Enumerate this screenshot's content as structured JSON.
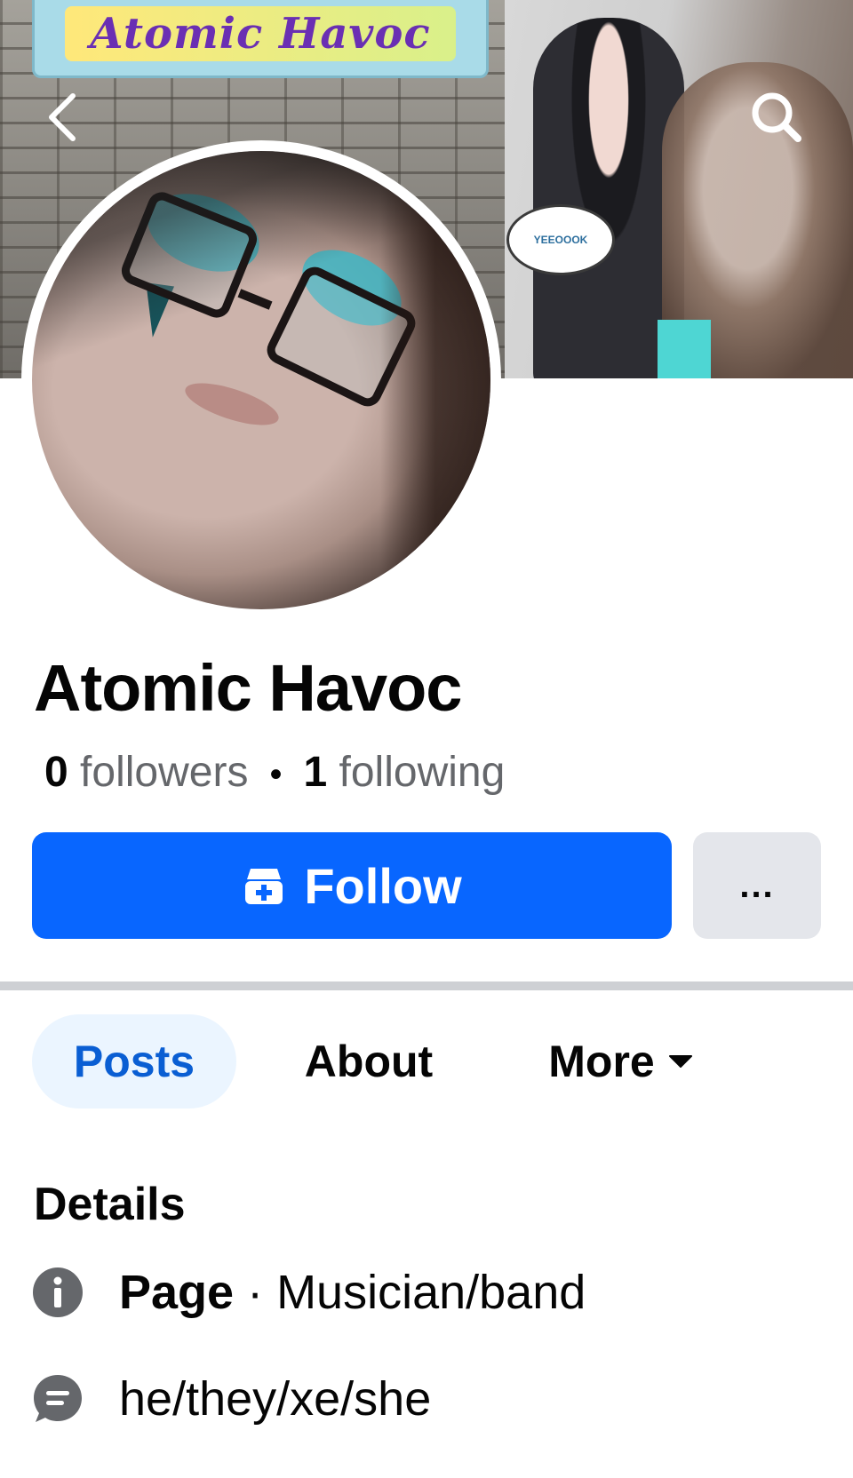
{
  "cover": {
    "sign_text": "Atomic Havoc",
    "bubble_text": "YEEOOOK"
  },
  "navigation": {
    "back_icon": "chevron-left-icon",
    "search_icon": "search-icon"
  },
  "profile": {
    "name": "Atomic Havoc",
    "followers_count": "0",
    "followers_label": "followers",
    "following_count": "1",
    "following_label": "following",
    "separator": "•"
  },
  "actions": {
    "follow_label": "Follow",
    "follow_icon": "follow-page-icon",
    "more_label": "...",
    "follow_color": "#0866ff"
  },
  "tabs": [
    {
      "label": "Posts",
      "active": true
    },
    {
      "label": "About",
      "active": false
    },
    {
      "label": "More",
      "active": false
    }
  ],
  "details": {
    "title": "Details",
    "items": [
      {
        "icon": "info-icon",
        "bold": "Page",
        "separator": " · ",
        "text": "Musician/band"
      },
      {
        "icon": "pronouns-icon",
        "bold": "",
        "separator": "",
        "text": "he/they/xe/she"
      }
    ]
  }
}
